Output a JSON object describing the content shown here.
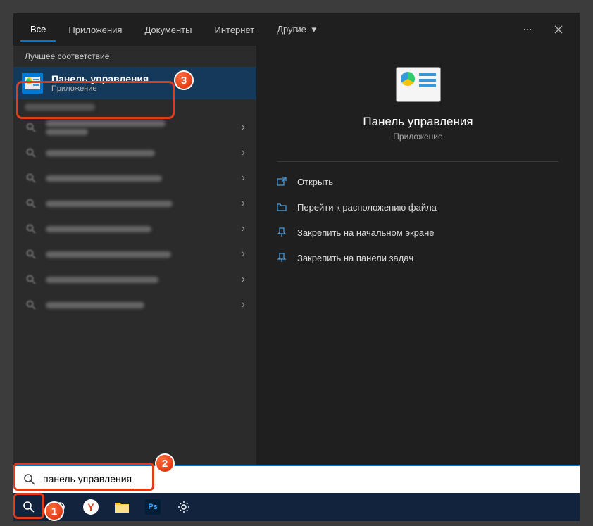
{
  "topbar": {
    "tabs": [
      "Все",
      "Приложения",
      "Документы",
      "Интернет",
      "Другие"
    ],
    "activeIndex": 0
  },
  "left": {
    "bestMatchHeader": "Лучшее соответствие",
    "result": {
      "title": "Панель управления",
      "subtitle": "Приложение"
    }
  },
  "right": {
    "title": "Панель управления",
    "subtitle": "Приложение",
    "actions": {
      "open": "Открыть",
      "location": "Перейти к расположению файла",
      "pinStart": "Закрепить на начальном экране",
      "pinTaskbar": "Закрепить на панели задач"
    }
  },
  "search": {
    "value": "панель управления",
    "placeholder": ""
  },
  "callouts": {
    "c1": "1",
    "c2": "2",
    "c3": "3"
  }
}
